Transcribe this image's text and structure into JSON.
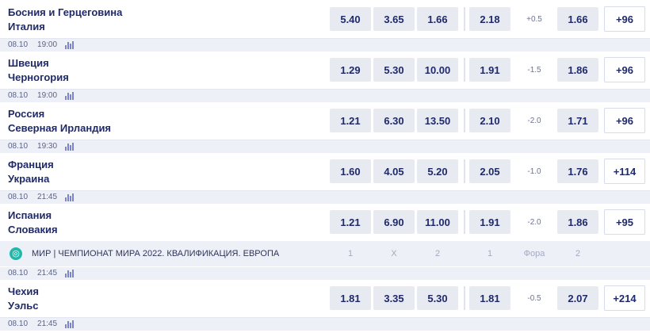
{
  "matches": [
    {
      "date": "",
      "time": "",
      "home": "Босния и Герцеговина",
      "away": "Италия",
      "odds": [
        "5.40",
        "3.65",
        "1.66",
        "2.18"
      ],
      "handicap": "+0.5",
      "fora_odd": "1.66",
      "more": "+96"
    },
    {
      "date": "08.10",
      "time": "19:00",
      "home": "Швеция",
      "away": "Черногория",
      "odds": [
        "1.29",
        "5.30",
        "10.00",
        "1.91"
      ],
      "handicap": "-1.5",
      "fora_odd": "1.86",
      "more": "+96"
    },
    {
      "date": "08.10",
      "time": "19:00",
      "home": "Россия",
      "away": "Северная Ирландия",
      "odds": [
        "1.21",
        "6.30",
        "13.50",
        "2.10"
      ],
      "handicap": "-2.0",
      "fora_odd": "1.71",
      "more": "+96"
    },
    {
      "date": "08.10",
      "time": "19:30",
      "home": "Франция",
      "away": "Украина",
      "odds": [
        "1.60",
        "4.05",
        "5.20",
        "2.05"
      ],
      "handicap": "-1.0",
      "fora_odd": "1.76",
      "more": "+114"
    },
    {
      "date": "08.10",
      "time": "21:45",
      "home": "Испания",
      "away": "Словакия",
      "odds": [
        "1.21",
        "6.90",
        "11.00",
        "1.91"
      ],
      "handicap": "-2.0",
      "fora_odd": "1.86",
      "more": "+95"
    },
    {
      "date": "08.10",
      "time": "21:45",
      "home": "Чехия",
      "away": "Уэльс",
      "odds": [
        "1.81",
        "3.35",
        "5.30",
        "1.81"
      ],
      "handicap": "-0.5",
      "fora_odd": "2.07",
      "more": "+214"
    }
  ],
  "league": {
    "icon": "globe-icon",
    "name": "МИР | ЧЕМПИОНАТ МИРА 2022. КВАЛИФИКАЦИЯ. ЕВРОПА",
    "headers": [
      "1",
      "X",
      "2",
      "1",
      "Фора",
      "2"
    ]
  },
  "next_match": {
    "date": "08.10",
    "time": "21:45"
  },
  "colors": {
    "text": "#1f2a6b",
    "odd_bg": "#e8eaf2",
    "meta_bg": "#eef0f7",
    "globe": "#22b8a9"
  }
}
